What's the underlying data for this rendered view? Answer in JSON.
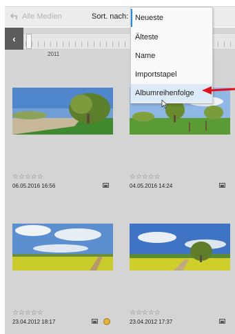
{
  "toolbar": {
    "back_label": "Alle Medien",
    "sort_label": "Sort. nach:"
  },
  "sort_menu": {
    "options": [
      "Neueste",
      "Älteste",
      "Name",
      "Importstapel",
      "Albumreihenfolge"
    ],
    "selected": "Neueste",
    "highlighted": "Albumreihenfolge"
  },
  "timeline": {
    "year": "2011",
    "prev_glyph": "‹"
  },
  "grid": {
    "items": [
      {
        "rating": "☆☆☆☆☆",
        "date": "06.05.2016 16:56",
        "icons": [
          "photo-icon"
        ]
      },
      {
        "rating": "☆☆☆☆☆",
        "date": "04.05.2016 14:24",
        "icons": [
          "photo-icon"
        ]
      },
      {
        "rating": "☆☆☆☆☆",
        "date": "23.04.2012 18:17",
        "icons": [
          "photo-icon",
          "stack-icon"
        ]
      },
      {
        "rating": "☆☆☆☆☆",
        "date": "23.04.2012 17:37",
        "icons": [
          "photo-icon"
        ]
      }
    ]
  },
  "colors": {
    "accent": "#1f8ae8",
    "annotation_arrow": "#e0101a",
    "menu_hover": "#ddeaf7"
  }
}
